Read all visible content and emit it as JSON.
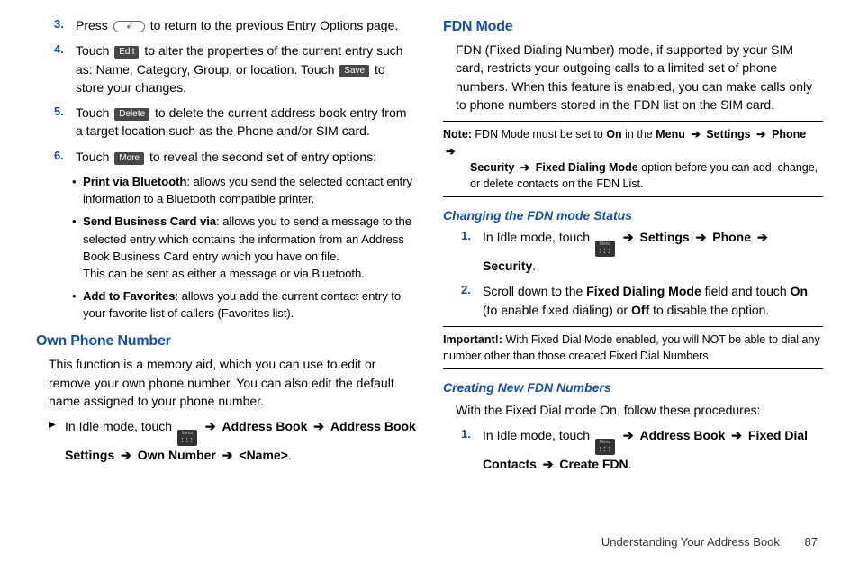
{
  "left": {
    "step3": {
      "pre": "Press ",
      "post": " to return to the previous Entry Options page."
    },
    "step4": {
      "t1": "Touch ",
      "edit": "Edit",
      "t2": " to alter the properties of the current entry such as: Name, Category, Group, or location. Touch ",
      "save": "Save",
      "t3": " to store your changes."
    },
    "step5": {
      "t1": "Touch ",
      "del": "Delete",
      "t2": " to delete the current address book entry from a target location such as the Phone and/or SIM card."
    },
    "step6": {
      "t1": "Touch ",
      "more": "More",
      "t2": " to reveal the second set of entry options:"
    },
    "bullets": {
      "b1_bold": "Print via Bluetooth",
      "b1_text": ": allows you send the selected contact entry information to a Bluetooth compatible printer.",
      "b2_bold": "Send Business Card via",
      "b2_text": ": allows you to send a message to the selected entry which contains the information from an Address Book Business Card entry which you have on file.",
      "b2_line2": "This can be sent as either a message or via Bluetooth.",
      "b3_bold": "Add to Favorites",
      "b3_text": ": allows you add the current contact entry to your favorite list of callers (Favorites list)."
    },
    "own_h": "Own Phone Number",
    "own_p": "This function is a memory aid, which you can use to edit or remove your own phone number. You can also edit the default name assigned to your phone number.",
    "own_step": {
      "t1": "In Idle mode, touch ",
      "path1": "Address Book",
      "path2": "Address Book Settings",
      "path3": "Own Number",
      "path4": "<Name>"
    }
  },
  "right": {
    "fdn_h": "FDN Mode",
    "fdn_p": "FDN (Fixed Dialing Number) mode, if supported by your SIM card, restricts your outgoing calls to a limited set of phone numbers. When this feature is enabled, you can make calls only to phone numbers stored in the FDN list on the SIM card.",
    "note": {
      "lead": "Note:",
      "t1": " FDN Mode must be set to ",
      "on": "On",
      "t2": " in the ",
      "menu": "Menu",
      "settings": "Settings",
      "phone": "Phone",
      "security": "Security",
      "fdm": "Fixed Dialing Mode",
      "t3": " option before you can add, change, or delete contacts on the FDN List."
    },
    "chg_h": "Changing the FDN mode Status",
    "chg_s1": {
      "t1": "In Idle mode, touch ",
      "settings": "Settings",
      "phone": "Phone",
      "security": "Security"
    },
    "chg_s2": {
      "t1": "Scroll down to the ",
      "fdm": "Fixed Dialing Mode",
      "t2": " field and touch ",
      "on": "On",
      "t3": " (to enable fixed dialing) or ",
      "off": "Off",
      "t4": " to disable the option."
    },
    "imp": {
      "lead": "Important!:",
      "text": " With Fixed Dial Mode enabled, you will NOT be able to dial any number other than those created Fixed Dial Numbers."
    },
    "cre_h": "Creating New FDN Numbers",
    "cre_p": "With the Fixed Dial mode On, follow these procedures:",
    "cre_s1": {
      "t1": "In Idle mode, touch ",
      "ab": "Address Book",
      "fdc": "Fixed Dial Contacts",
      "cf": "Create FDN"
    }
  },
  "footer": {
    "label": "Understanding Your Address Book",
    "page": "87"
  },
  "icons": {
    "back_glyph": "⤶",
    "menu_label": "Menu",
    "arrow": "➔"
  }
}
